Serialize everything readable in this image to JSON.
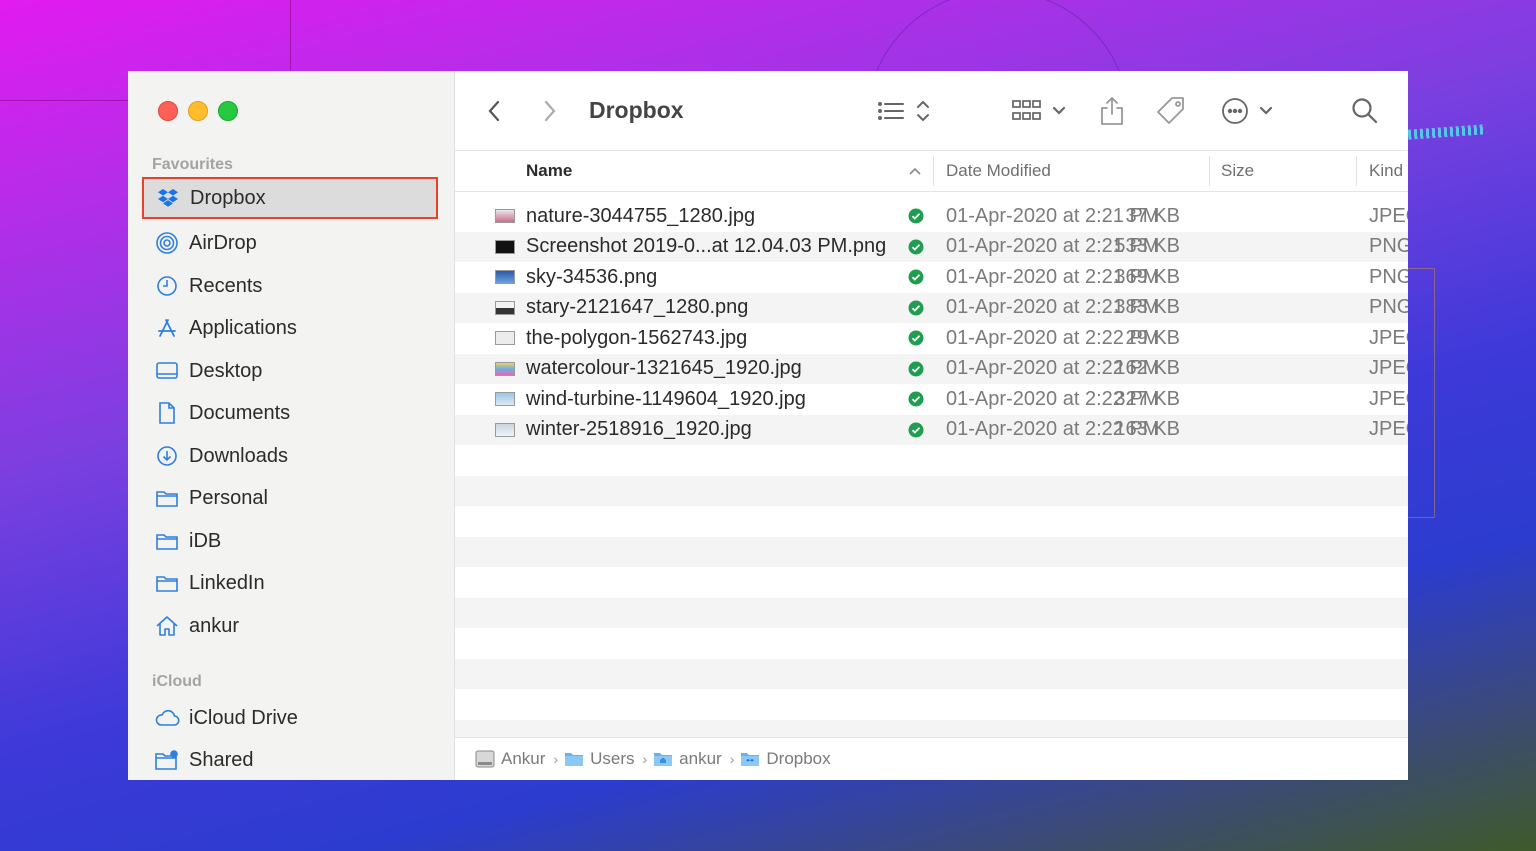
{
  "sidebar": {
    "favourites_label": "Favourites",
    "icloud_label": "iCloud",
    "items": [
      {
        "label": "Dropbox"
      },
      {
        "label": "AirDrop"
      },
      {
        "label": "Recents"
      },
      {
        "label": "Applications"
      },
      {
        "label": "Desktop"
      },
      {
        "label": "Documents"
      },
      {
        "label": "Downloads"
      },
      {
        "label": "Personal"
      },
      {
        "label": "iDB"
      },
      {
        "label": "LinkedIn"
      },
      {
        "label": "ankur"
      }
    ],
    "icloud_items": [
      {
        "label": "iCloud Drive"
      },
      {
        "label": "Shared"
      }
    ]
  },
  "toolbar": {
    "title": "Dropbox"
  },
  "columns": {
    "name": "Name",
    "date": "Date Modified",
    "size": "Size",
    "kind": "Kind"
  },
  "files": [
    {
      "name": "nature-3044755_1280.jpg",
      "date": "01-Apr-2020 at 2:21 PM",
      "size": "37 KB",
      "kind": "JPEG"
    },
    {
      "name": "Screenshot 2019-0...at 12.04.03 PM.png",
      "date": "01-Apr-2020 at 2:21 PM",
      "size": "533 KB",
      "kind": "PNG"
    },
    {
      "name": "sky-34536.png",
      "date": "01-Apr-2020 at 2:21 PM",
      "size": "369 KB",
      "kind": "PNG"
    },
    {
      "name": "stary-2121647_1280.png",
      "date": "01-Apr-2020 at 2:21 PM",
      "size": "383 KB",
      "kind": "PNG"
    },
    {
      "name": "the-polygon-1562743.jpg",
      "date": "01-Apr-2020 at 2:22 PM",
      "size": "29 KB",
      "kind": "JPEG"
    },
    {
      "name": "watercolour-1321645_1920.jpg",
      "date": "01-Apr-2020 at 2:22 PM",
      "size": "162 KB",
      "kind": "JPEG"
    },
    {
      "name": "wind-turbine-1149604_1920.jpg",
      "date": "01-Apr-2020 at 2:22 PM",
      "size": "327 KB",
      "kind": "JPEG"
    },
    {
      "name": "winter-2518916_1920.jpg",
      "date": "01-Apr-2020 at 2:22 PM",
      "size": "163 KB",
      "kind": "JPEG"
    }
  ],
  "pathbar": {
    "crumbs": [
      {
        "label": "Ankur"
      },
      {
        "label": "Users"
      },
      {
        "label": "ankur"
      },
      {
        "label": "Dropbox"
      }
    ]
  },
  "colors": {
    "selection_outline": "#e8402a",
    "sync_green": "#1e9e4e",
    "folder_blue": "#3b8fe0"
  }
}
